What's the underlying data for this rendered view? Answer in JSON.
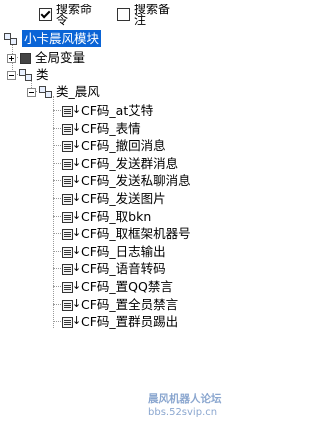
{
  "options": {
    "search_name": {
      "label": "搜索命令",
      "checked": true
    },
    "search_note": {
      "label": "搜索备注",
      "checked": false
    }
  },
  "tree": {
    "root": "小卡晨风模块",
    "global_vars": "全局变量",
    "class_group": "类",
    "class_node": "类_晨风",
    "items": [
      "CF码_at艾特",
      "CF码_表情",
      "CF码_撤回消息",
      "CF码_发送群消息",
      "CF码_发送私聊消息",
      "CF码_发送图片",
      "CF码_取bkn",
      "CF码_取框架机器号",
      "CF码_日志输出",
      "CF码_语音转码",
      "CF码_置QQ禁言",
      "CF码_置全员禁言",
      "CF码_置群员踢出"
    ]
  },
  "watermark": {
    "title": "晨风机器人论坛",
    "url": "bbs.52svip.cn"
  },
  "colors": {
    "selection": "#0a64d6",
    "watermark": "#2b5ea8"
  }
}
